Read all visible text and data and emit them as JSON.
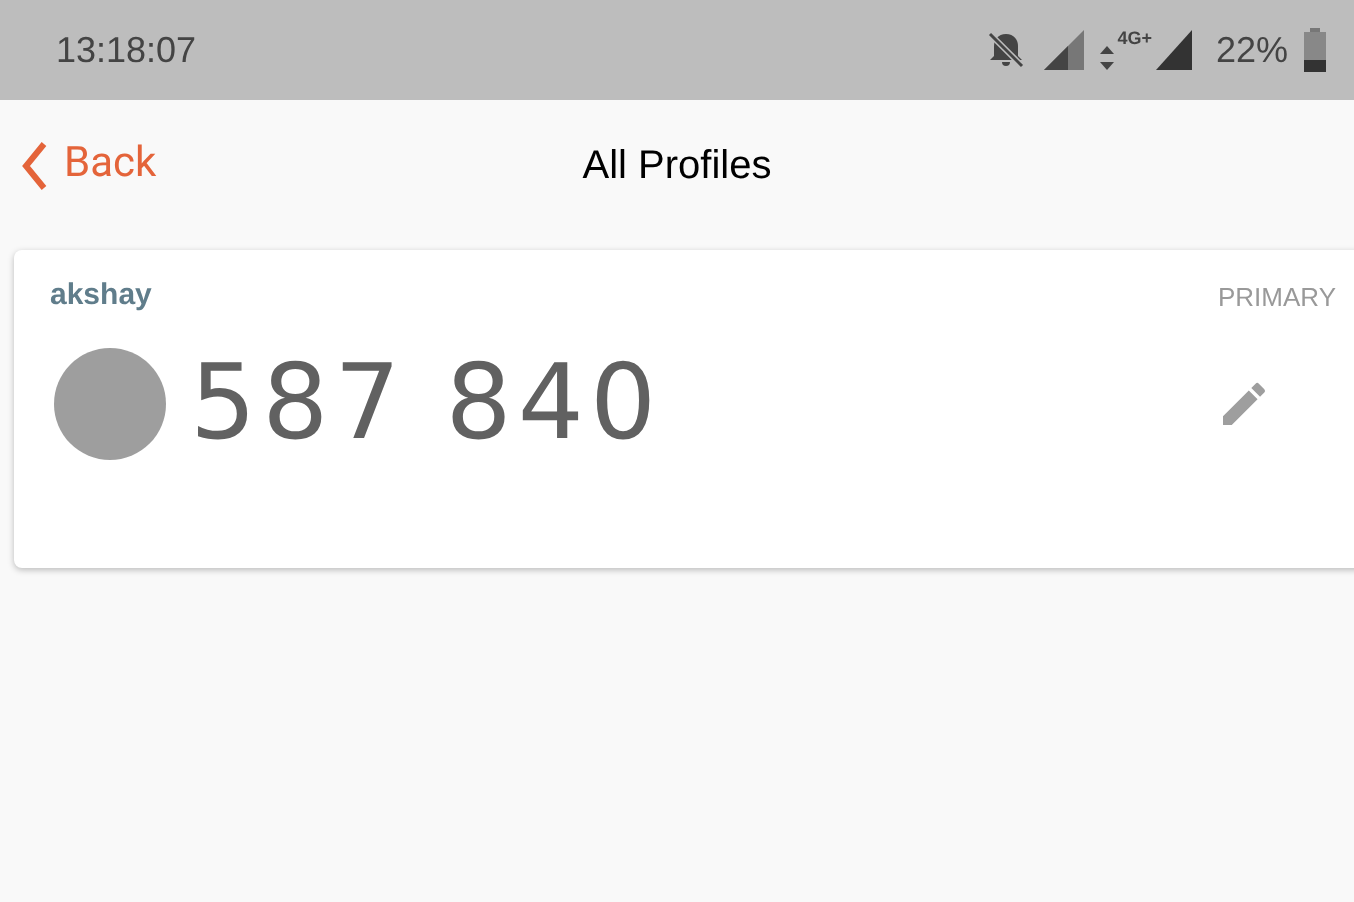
{
  "status_bar": {
    "time": "13:18:07",
    "network": "4G+",
    "battery": "22%"
  },
  "header": {
    "back": "Back",
    "title": "All Profiles"
  },
  "profiles": [
    {
      "name": "akshay",
      "tag": "PRIMARY",
      "code": "587 840"
    }
  ]
}
